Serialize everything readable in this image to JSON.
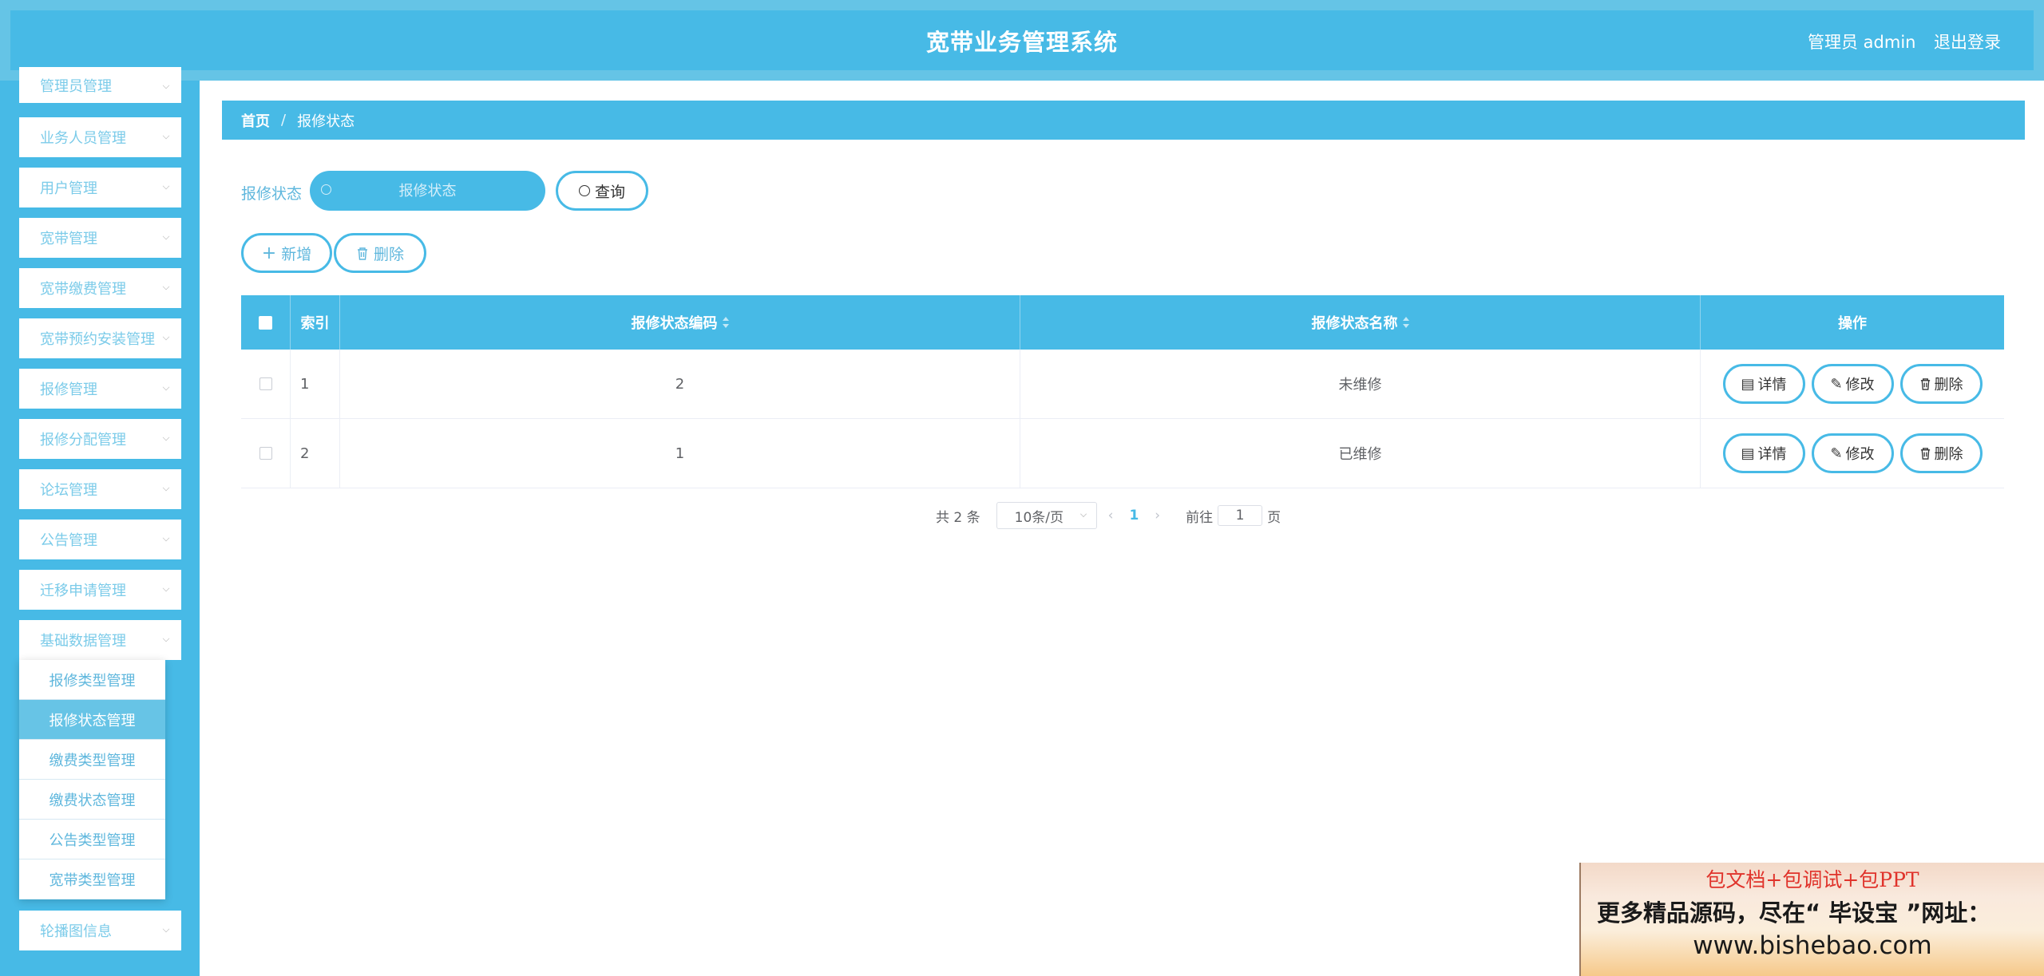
{
  "header": {
    "title": "宽带业务管理系统",
    "user": "管理员 admin",
    "logout": "退出登录"
  },
  "sidebar": {
    "items": [
      {
        "label": "管理员管理"
      },
      {
        "label": "业务人员管理"
      },
      {
        "label": "用户管理"
      },
      {
        "label": "宽带管理"
      },
      {
        "label": "宽带缴费管理"
      },
      {
        "label": "宽带预约安装管理"
      },
      {
        "label": "报修管理"
      },
      {
        "label": "报修分配管理"
      },
      {
        "label": "论坛管理"
      },
      {
        "label": "公告管理"
      },
      {
        "label": "迁移申请管理"
      },
      {
        "label": "基础数据管理"
      },
      {
        "label": "轮播图信息"
      }
    ],
    "submenu": [
      {
        "label": "报修类型管理"
      },
      {
        "label": "报修状态管理"
      },
      {
        "label": "缴费类型管理"
      },
      {
        "label": "缴费状态管理"
      },
      {
        "label": "公告类型管理"
      },
      {
        "label": "宽带类型管理"
      }
    ]
  },
  "breadcrumb": {
    "home": "首页",
    "separator": "/",
    "current": "报修状态"
  },
  "search": {
    "label": "报修状态",
    "placeholder": "报修状态",
    "query_button": "查询"
  },
  "actions": {
    "add": "新增",
    "delete": "删除"
  },
  "table": {
    "columns": [
      "索引",
      "报修状态编码",
      "报修状态名称",
      "操作"
    ],
    "rows": [
      {
        "index": "1",
        "code": "2",
        "name": "未维修"
      },
      {
        "index": "2",
        "code": "1",
        "name": "已维修"
      }
    ],
    "row_actions": {
      "detail": "详情",
      "edit": "修改",
      "delete": "删除"
    }
  },
  "pagination": {
    "total": "共 2 条",
    "page_size": "10条/页",
    "current_page": "1",
    "goto_label": "前往",
    "goto_value": "1",
    "page_unit": "页"
  },
  "watermark": {
    "line1": "包文档+包调试+包PPT",
    "line2": "更多精品源码，尽在“ 毕设宝 ”网址：",
    "line3": "www.bishebao.com"
  },
  "colors": {
    "primary": "#47bae6",
    "header_outer": "#65c4e6",
    "menu_text": "#7bcbe9"
  }
}
